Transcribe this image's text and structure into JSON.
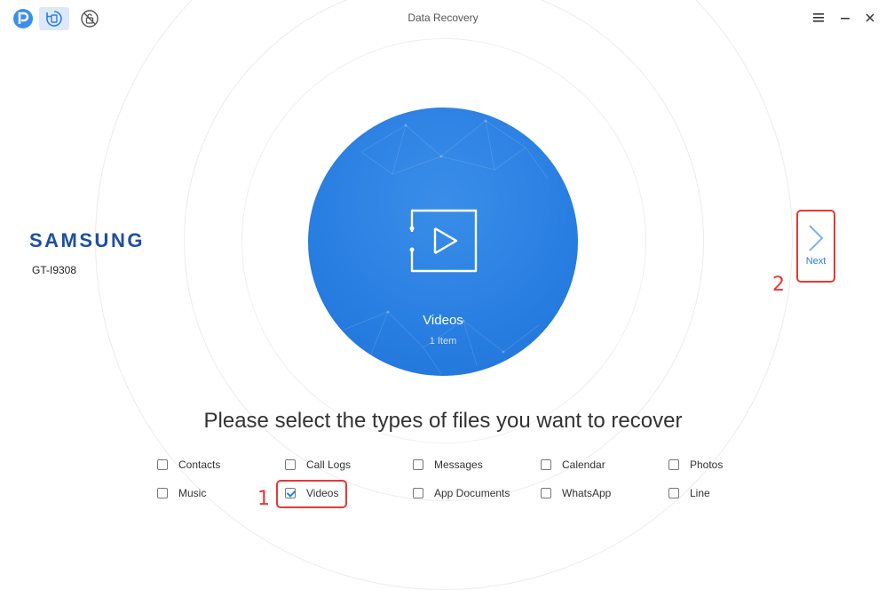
{
  "app": {
    "window_title": "Data Recovery",
    "nav_icons": [
      "phonerescue-logo-icon",
      "data-recovery-icon",
      "unlock-icon"
    ],
    "window_controls": [
      "menu-icon",
      "minimize-icon",
      "close-icon"
    ]
  },
  "device": {
    "brand": "SAMSUNG",
    "model": "GT-I9308"
  },
  "preview": {
    "icon": "video-play-icon",
    "label": "Videos",
    "count": "1 Item",
    "color": "#2a7fe2"
  },
  "next": {
    "label": "Next"
  },
  "annotations": {
    "step1": "1",
    "step2": "2",
    "color": "#e53935"
  },
  "prompt": "Please select the types of files you want to recover",
  "file_types": [
    {
      "label": "Contacts",
      "checked": false
    },
    {
      "label": "Call Logs",
      "checked": false
    },
    {
      "label": "Messages",
      "checked": false
    },
    {
      "label": "Calendar",
      "checked": false
    },
    {
      "label": "Photos",
      "checked": false
    },
    {
      "label": "Music",
      "checked": false
    },
    {
      "label": "Videos",
      "checked": true
    },
    {
      "label": "App Documents",
      "checked": false
    },
    {
      "label": "WhatsApp",
      "checked": false
    },
    {
      "label": "Line",
      "checked": false
    }
  ]
}
